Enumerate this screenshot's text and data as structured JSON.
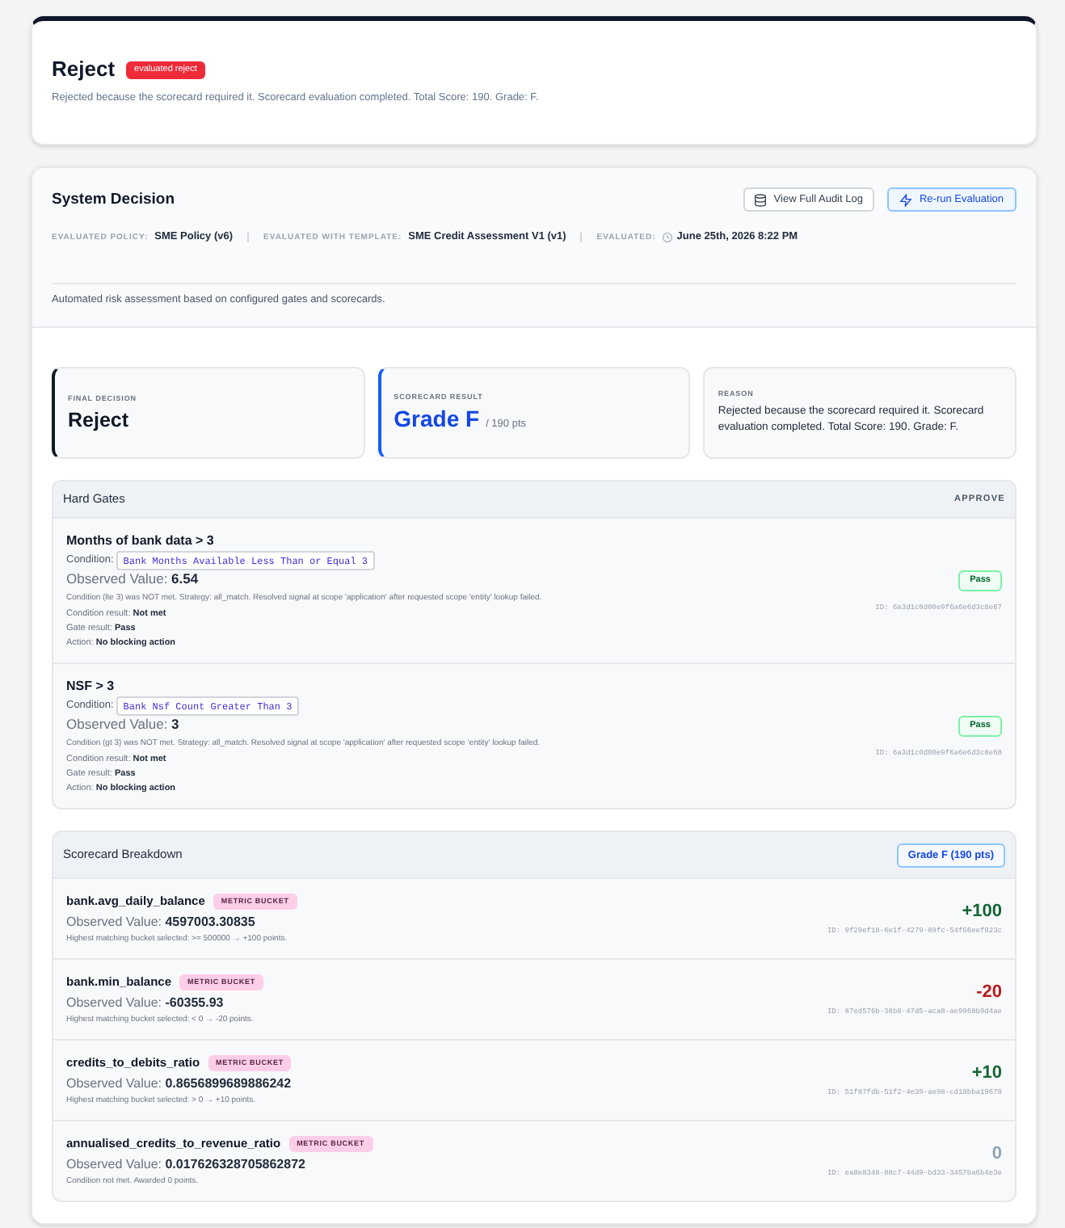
{
  "decision_header": {
    "title": "Reject",
    "badge": "evaluated reject",
    "summary": "Rejected because the scorecard required it. Scorecard evaluation completed. Total Score: 190. Grade: F."
  },
  "system_decision": {
    "title": "System Decision",
    "buttons": [
      {
        "label": "View Full Audit Log",
        "kind": "audit"
      },
      {
        "label": "Re-run Evaluation",
        "kind": "rerun"
      }
    ],
    "meta": [
      {
        "label": "EVALUATED POLICY:",
        "value": "SME Policy (v6)",
        "kind": "plain"
      },
      {
        "label": "EVALUATED WITH TEMPLATE:",
        "value": "SME Credit Assessment V1 (v1)",
        "kind": "plain"
      },
      {
        "label": "EVALUATED:",
        "value": "June 25th, 2026 8:22 PM",
        "kind": "time"
      }
    ],
    "description": "Automated risk assessment based on configured gates and scorecards."
  },
  "summary_cards": [
    {
      "kind": "decision",
      "label": "FINAL DECISION",
      "value": "Reject"
    },
    {
      "kind": "score",
      "label": "SCORECARD RESULT",
      "value": "Grade F",
      "suffix": "/ 190 pts"
    },
    {
      "kind": "reason",
      "label": "REASON",
      "value": "Rejected because the scorecard required it. Scorecard evaluation completed. Total Score: 190. Grade: F."
    }
  ],
  "hard_gates": {
    "title": "Hard Gates",
    "outcome": "APPROVE",
    "gates": [
      {
        "name": "Months of bank data > 3",
        "condition_label": "Condition:",
        "condition": "Bank Months Available Less Than or Equal 3",
        "observed": "Observed Value: **6.54**",
        "explanation": "Condition (lte 3) was NOT met. Strategy: all_match. Resolved signal at scope 'application' after requested scope 'entity' lookup failed.",
        "details": [
          "Condition result: **Not met**",
          "Gate result: **Pass**",
          "Action: **No blocking action**"
        ],
        "result": "Pass",
        "id": "ID: 6a3d1c0d00e9f6a6e6d3c8e67"
      },
      {
        "name": "NSF > 3",
        "condition_label": "Condition:",
        "condition": "Bank Nsf Count Greater Than 3",
        "observed": "Observed Value: **3**",
        "explanation": "Condition (gt 3) was NOT met. Strategy: all_match. Resolved signal at scope 'application' after requested scope 'entity' lookup failed.",
        "details": [
          "Condition result: **Not met**",
          "Gate result: **Pass**",
          "Action: **No blocking action**"
        ],
        "result": "Pass",
        "id": "ID: 6a3d1c0d00e9f6a6e6d3c8e68"
      }
    ]
  },
  "scorecard": {
    "title": "Scorecard Breakdown",
    "grade": "Grade F (190 pts)",
    "items": [
      {
        "name": "bank.avg_daily_balance",
        "tag": "METRIC BUCKET",
        "observed": "Observed Value: **4597003.30835**",
        "note": "Highest matching bucket selected: >= 500000 → +100 points.",
        "points": "+100",
        "color": "#166534",
        "id": "ID: 9f29ef18-6e1f-4279-89fc-54f56eef923c"
      },
      {
        "name": "bank.min_balance",
        "tag": "METRIC BUCKET",
        "observed": "Observed Value: **-60355.93**",
        "note": "Highest matching bucket selected: < 0 → -20 points.",
        "points": "-20",
        "color": "#b91c1c",
        "id": "ID: 87ed576b-38b8-47d5-aca8-ae9968b9d4ae"
      },
      {
        "name": "credits_to_debits_ratio",
        "tag": "METRIC BUCKET",
        "observed": "Observed Value: **0.8656899689886242**",
        "note": "Highest matching bucket selected: > 0 → +10 points.",
        "points": "+10",
        "color": "#166534",
        "id": "ID: 51f87fdb-51f2-4e39-ae98-cd18bba19678"
      },
      {
        "name": "annualised_credits_to_revenue_ratio",
        "tag": "METRIC BUCKET",
        "observed": "Observed Value: **0.017626328705862872**",
        "note": "Condition not met. Awarded 0 points.",
        "points": "0",
        "color": "#94a3b8",
        "id": "ID: ea8e8348-88c7-44d9-bd33-3457ba6b4e3e"
      }
    ]
  }
}
